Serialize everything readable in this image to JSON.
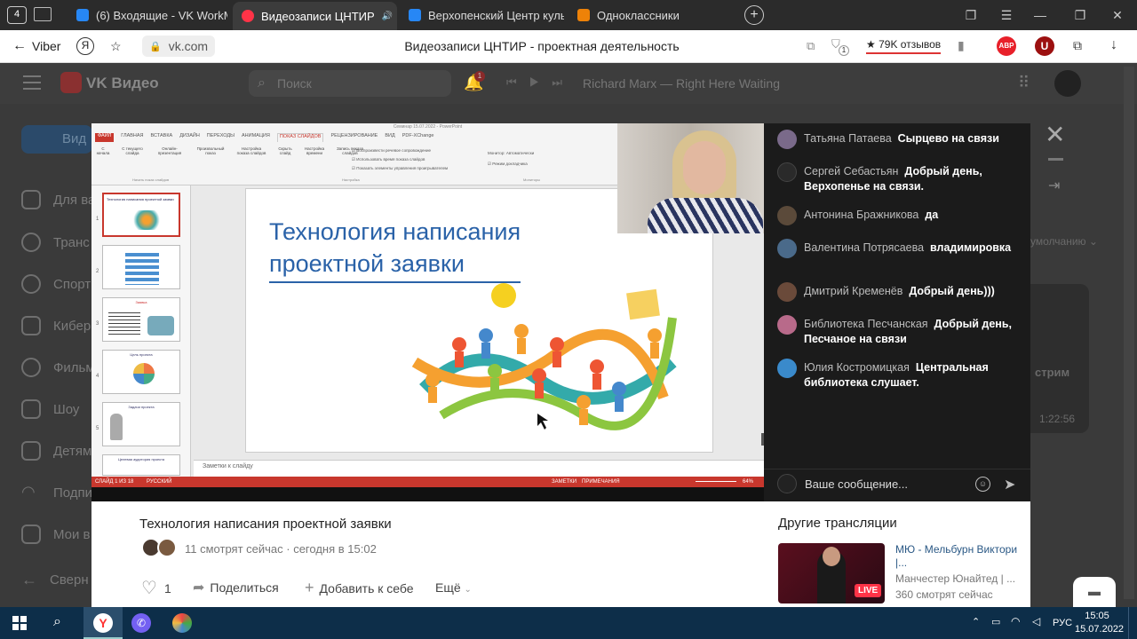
{
  "browser": {
    "tab_count_badge": "4",
    "tabs": [
      {
        "label": "(6) Входящие - VK WorkM",
        "color": "#2787f5"
      },
      {
        "label": "Видеозаписи ЦНТИР",
        "color": "#ff3347",
        "active": true
      },
      {
        "label": "Верхопенский Центр куль",
        "color": "#2787f5"
      },
      {
        "label": "Одноклассники",
        "color": "#ee8208"
      }
    ],
    "back_label": "Viber",
    "url": "vk.com",
    "page_title": "Видеозаписи ЦНТИР - проектная деятельность",
    "reviews": "79K отзывов",
    "notif_count": "1",
    "ext_abp": "ABP",
    "ext_u": "U"
  },
  "vk": {
    "logo": "VK Видео",
    "search_placeholder": "Поиск",
    "notif_badge": "1",
    "track": "Richard Marx — Right Here Waiting",
    "sidebar": [
      {
        "label": "Вид"
      },
      {
        "label": "Для ва"
      },
      {
        "label": "Транс"
      },
      {
        "label": "Спорт"
      },
      {
        "label": "Кибер"
      },
      {
        "label": "Фильм"
      },
      {
        "label": "Шоу"
      },
      {
        "label": "Детям"
      },
      {
        "label": "Подпи"
      },
      {
        "label": "Мои в"
      },
      {
        "label": "Сверн"
      }
    ],
    "bg_right_text": "умолчанию",
    "bg_card_text": "стрим",
    "bg_card_time": "1:22:56"
  },
  "ppt": {
    "window_title": "Семинар 15.07.2022 - PowerPoint",
    "tabs": [
      "ФАЙЛ",
      "ГЛАВНАЯ",
      "ВСТАВКА",
      "ДИЗАЙН",
      "ПЕРЕХОДЫ",
      "АНИМАЦИЯ",
      "ПОКАЗ СЛАЙДОВ",
      "РЕЦЕНЗИРОВАНИЕ",
      "ВИД",
      "PDF-XChange"
    ],
    "ribbon_buttons": [
      "С начала",
      "С текущего слайда",
      "Онлайн-презентация",
      "Произвольный показ",
      "Настройка показа слайдов",
      "Скрыть слайд",
      "Настройка времени",
      "Запись показа слайдов"
    ],
    "ribbon_checks": [
      "Воспроизвести речевое сопровождение",
      "Использовать время показа слайдов",
      "Показать элементы управления проигрывателем"
    ],
    "monitor_label": "Монитор: Автоматически",
    "presenter_view": "Режим докладчика",
    "group_labels": [
      "Начать показ слайдов",
      "Настройка",
      "Мониторы"
    ],
    "thumb_titles": [
      "Технология написания проектной заявки",
      "",
      "Заявка",
      "Цель проекта",
      "Задачи проекта",
      "Целевая аудитория проекта"
    ],
    "slide_title_line1": "Технология написания",
    "slide_title_line2": "проектной заявки",
    "notes_placeholder": "Заметки к слайду",
    "status_left": "СЛАЙД 1 ИЗ 18",
    "status_lang": "РУССКИЙ",
    "status_notes": "ЗАМЕТКИ",
    "status_comments": "ПРИМЕЧАНИЯ",
    "zoom": "64%"
  },
  "chat": {
    "messages": [
      {
        "name": "Татьяна Патаева",
        "text": "Сырцево на связи",
        "avatar": "#7a6a8a"
      },
      {
        "name": "Сергей Себастьян",
        "text": "Добрый день, Верхопенье на связи.",
        "avatar": "#2a2a2a"
      },
      {
        "name": "Антонина Бражникова",
        "text": "да",
        "avatar": "#5b4a3a"
      },
      {
        "name": "Валентина Потрясаева",
        "text": "владимировка",
        "avatar": "#4a6a8a"
      },
      {
        "name": "Дмитрий Кременёв",
        "text": "Добрый день)))",
        "avatar": "#6a4a3a"
      },
      {
        "name": "Библиотека Песчанская",
        "text": "Добрый день, Песчаное на связи",
        "avatar": "#b86a8a"
      },
      {
        "name": "Юлия Костромицкая",
        "text": "Центральная библиотека слушает.",
        "avatar": "#3a8acb"
      }
    ],
    "input_placeholder": "Ваше сообщение..."
  },
  "video": {
    "title": "Технология написания проектной заявки",
    "viewers": "11 смотрят сейчас",
    "time": "сегодня в 15:02",
    "likes": "1",
    "share": "Поделиться",
    "add": "Добавить к себе",
    "more": "Ещё"
  },
  "other": {
    "heading": "Другие трансляции",
    "title": "МЮ - Мельбурн Виктори |...",
    "channel": "Манчестер Юнайтед | ...",
    "viewers": "360 смотрят сейчас",
    "live": "LIVE"
  },
  "taskbar": {
    "lang": "РУС",
    "time": "15:05",
    "date": "15.07.2022"
  }
}
